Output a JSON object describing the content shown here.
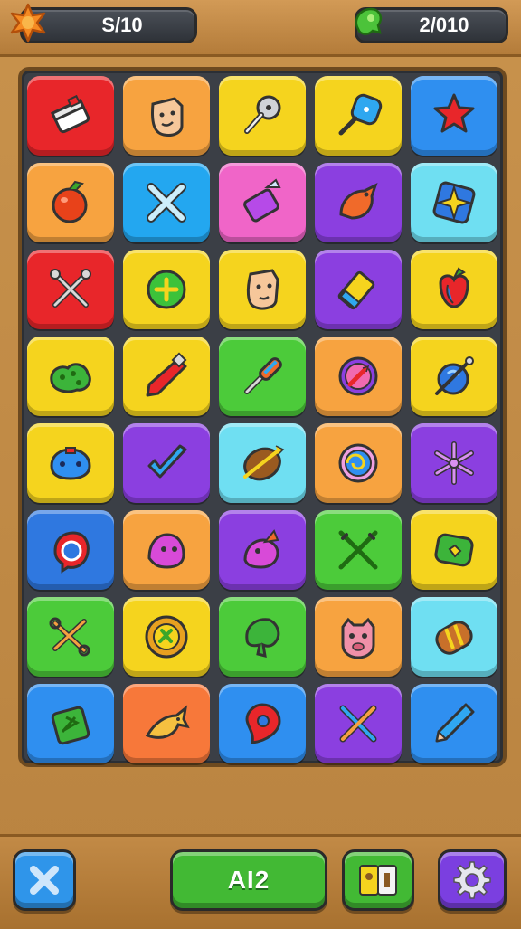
{
  "hud": {
    "left_value": "S/10",
    "left_icon": "orange-star-icon",
    "right_value": "2/010",
    "right_icon": "green-gem-icon"
  },
  "board": {
    "tiles": [
      {
        "color": "#e8262a",
        "icon": "white-box-icon"
      },
      {
        "color": "#f7a340",
        "icon": "smiling-face-icon"
      },
      {
        "color": "#f5d41e",
        "icon": "key-icon"
      },
      {
        "color": "#f5d41e",
        "icon": "blue-tag-icon"
      },
      {
        "color": "#2f8ff0",
        "icon": "red-star-icon"
      },
      {
        "color": "#f7a340",
        "icon": "tomato-icon"
      },
      {
        "color": "#23a7f0",
        "icon": "crossed-bones-icon"
      },
      {
        "color": "#f065c8",
        "icon": "purple-gift-icon"
      },
      {
        "color": "#8b3fe0",
        "icon": "red-bird-icon"
      },
      {
        "color": "#6fdff2",
        "icon": "compass-star-icon"
      },
      {
        "color": "#e8262a",
        "icon": "crossed-tools-icon"
      },
      {
        "color": "#f5d41e",
        "icon": "green-plus-icon"
      },
      {
        "color": "#f5d41e",
        "icon": "face-icon"
      },
      {
        "color": "#8b3fe0",
        "icon": "yellow-eraser-icon"
      },
      {
        "color": "#f5d41e",
        "icon": "red-apple-icon"
      },
      {
        "color": "#f5d41e",
        "icon": "green-blob-icon"
      },
      {
        "color": "#f5d41e",
        "icon": "red-pen-icon"
      },
      {
        "color": "#4ccb3a",
        "icon": "screwdriver-icon"
      },
      {
        "color": "#f7a340",
        "icon": "dartboard-icon"
      },
      {
        "color": "#f5d41e",
        "icon": "blue-ball-pin-icon"
      },
      {
        "color": "#f5d41e",
        "icon": "blue-blob-icon"
      },
      {
        "color": "#8b3fe0",
        "icon": "blue-check-icon"
      },
      {
        "color": "#6fdff2",
        "icon": "wooden-shield-icon"
      },
      {
        "color": "#f7a340",
        "icon": "spiral-icon"
      },
      {
        "color": "#8b3fe0",
        "icon": "snowflake-icon"
      },
      {
        "color": "#2f78e0",
        "icon": "red-ring-icon"
      },
      {
        "color": "#f7a340",
        "icon": "pink-ghost-icon"
      },
      {
        "color": "#8b3fe0",
        "icon": "pink-bird-icon"
      },
      {
        "color": "#4ccb3a",
        "icon": "crossed-swords-icon"
      },
      {
        "color": "#f5d41e",
        "icon": "green-bandage-icon"
      },
      {
        "color": "#4ccb3a",
        "icon": "scissors-icon"
      },
      {
        "color": "#f5d41e",
        "icon": "gear-coin-icon"
      },
      {
        "color": "#4ccb3a",
        "icon": "green-leaf-icon"
      },
      {
        "color": "#f7a340",
        "icon": "pig-face-icon"
      },
      {
        "color": "#6fdff2",
        "icon": "wooden-barrel-icon"
      },
      {
        "color": "#2f8ff0",
        "icon": "green-card-icon"
      },
      {
        "color": "#f7783a",
        "icon": "yellow-fish-icon"
      },
      {
        "color": "#2f8ff0",
        "icon": "red-pin-icon"
      },
      {
        "color": "#8b3fe0",
        "icon": "crossed-wands-icon"
      },
      {
        "color": "#2f8ff0",
        "icon": "pencil-icon"
      }
    ]
  },
  "footer": {
    "center_label": "AI2",
    "close_icon": "close-x-icon",
    "book_icon": "book-icon",
    "settings_icon": "gear-icon"
  }
}
